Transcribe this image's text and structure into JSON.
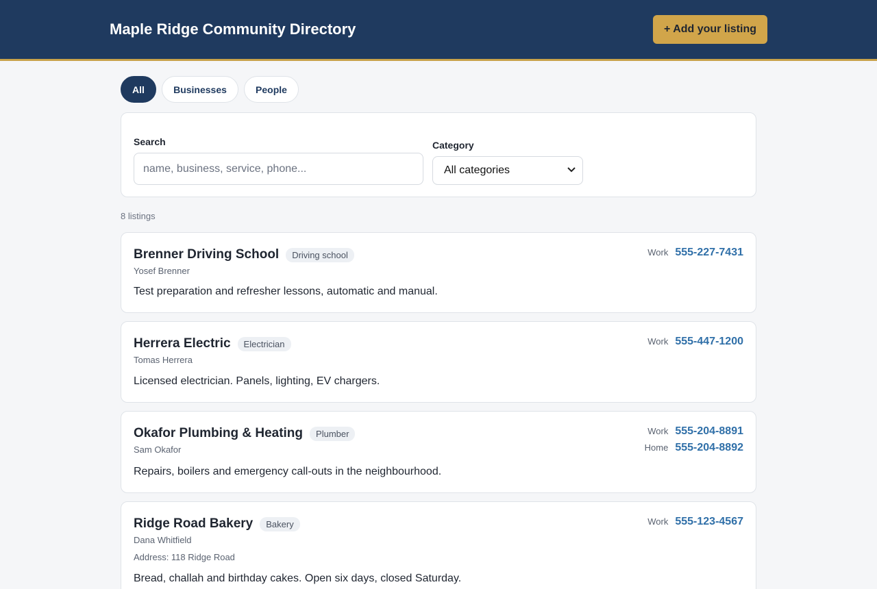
{
  "header": {
    "title": "Maple Ridge Community Directory",
    "add_label": "+ Add your listing"
  },
  "tabs": [
    {
      "label": "All",
      "active": true
    },
    {
      "label": "Businesses",
      "active": false
    },
    {
      "label": "People",
      "active": false
    }
  ],
  "filters": {
    "search_label": "Search",
    "search_placeholder": "name, business, service, phone...",
    "search_value": "",
    "category_label": "Category",
    "category_value": "All categories"
  },
  "count_text": "8 listings",
  "colors": {
    "header_bg": "#1f3a5f",
    "accent_gold": "#d1a54a",
    "phone_link": "#2f6fa8"
  },
  "listings": [
    {
      "name": "Brenner Driving School",
      "category": "Driving school",
      "person": "Yosef Brenner",
      "address": "",
      "description": "Test preparation and refresher lessons, automatic and manual.",
      "phones": [
        {
          "type": "Work",
          "number": "555-227-7431"
        }
      ]
    },
    {
      "name": "Herrera Electric",
      "category": "Electrician",
      "person": "Tomas Herrera",
      "address": "",
      "description": "Licensed electrician. Panels, lighting, EV chargers.",
      "phones": [
        {
          "type": "Work",
          "number": "555-447-1200"
        }
      ]
    },
    {
      "name": "Okafor Plumbing & Heating",
      "category": "Plumber",
      "person": "Sam Okafor",
      "address": "",
      "description": "Repairs, boilers and emergency call-outs in the neighbourhood.",
      "phones": [
        {
          "type": "Work",
          "number": "555-204-8891"
        },
        {
          "type": "Home",
          "number": "555-204-8892"
        }
      ]
    },
    {
      "name": "Ridge Road Bakery",
      "category": "Bakery",
      "person": "Dana Whitfield",
      "address": "Address: 118 Ridge Road",
      "description": "Bread, challah and birthday cakes. Open six days, closed Saturday.",
      "phones": [
        {
          "type": "Work",
          "number": "555-123-4567"
        }
      ]
    }
  ]
}
